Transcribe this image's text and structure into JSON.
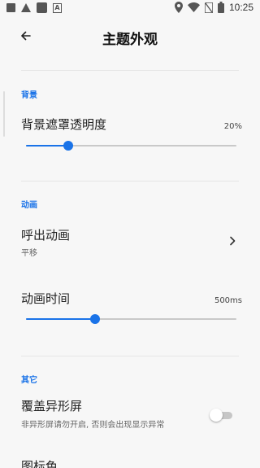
{
  "status_bar": {
    "time": "10:25",
    "icons": [
      "square-icon",
      "warning-icon",
      "app-icon",
      "a-icon",
      "location-icon",
      "wifi-icon",
      "no-sim-icon",
      "battery-icon"
    ]
  },
  "app_bar": {
    "title": "主题外观",
    "back_icon": "arrow-left-icon"
  },
  "sections": {
    "background": {
      "header": "背景",
      "opacity": {
        "title": "背景遮罩透明度",
        "value_label": "20%",
        "value": 0.2
      }
    },
    "animation": {
      "header": "动画",
      "breathe": {
        "title": "呼出动画",
        "subtitle": "平移"
      },
      "duration": {
        "title": "动画时间",
        "value_label": "500ms",
        "value": 0.33
      }
    },
    "other": {
      "header": "其它",
      "cover": {
        "title": "覆盖异形屏",
        "subtitle": "非异形屏请勿开启, 否则会出现显示异常",
        "enabled": false
      },
      "next_item_title": "图标色"
    }
  },
  "colors": {
    "accent": "#1a73e8",
    "background": "#f7f7f7",
    "track": "#c9c9c9"
  }
}
